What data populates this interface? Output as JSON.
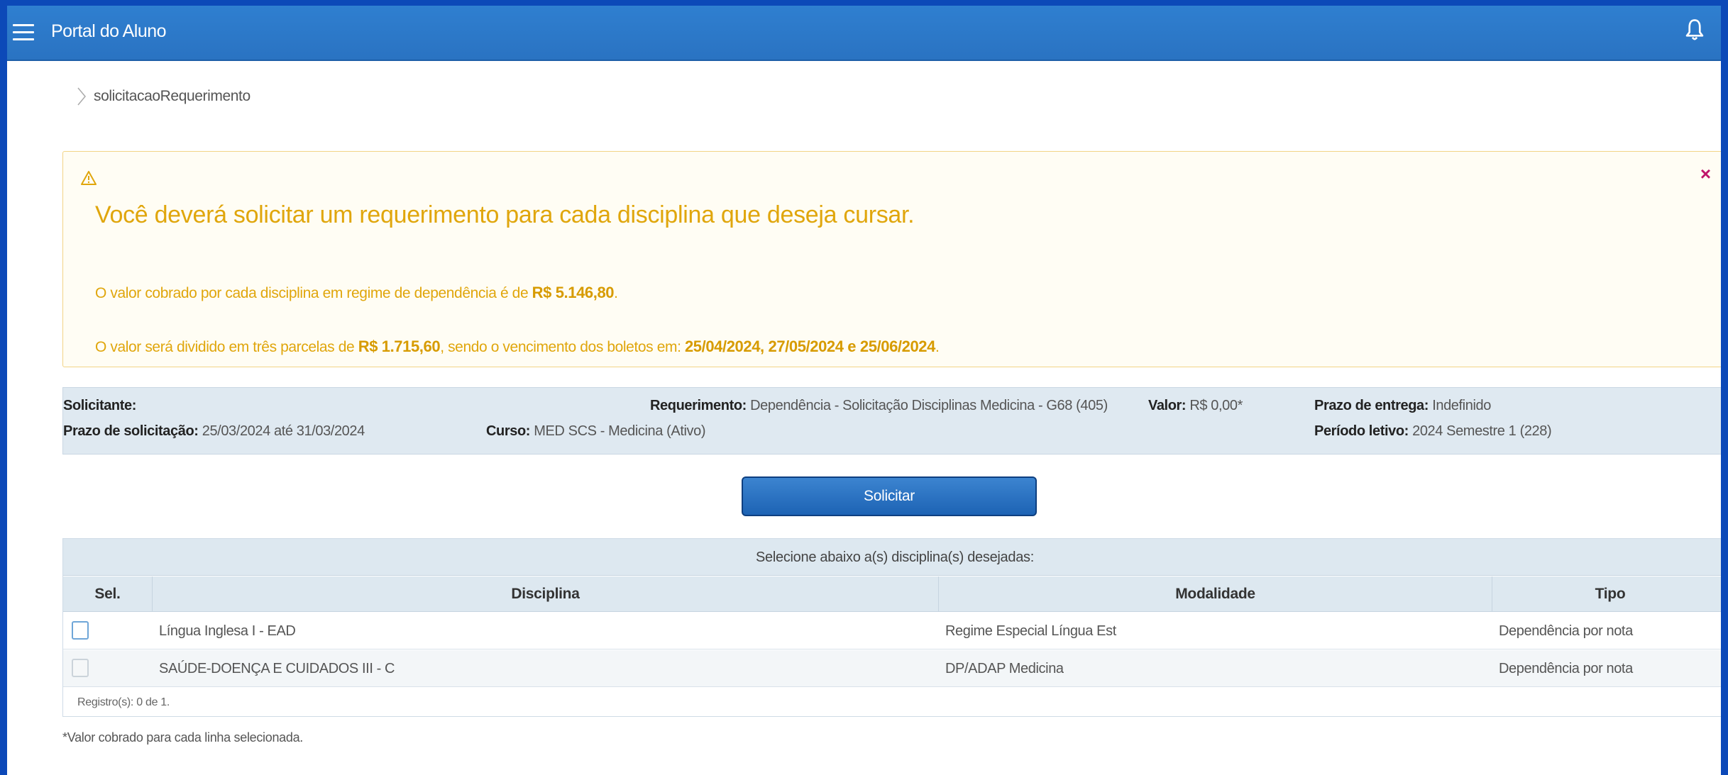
{
  "header": {
    "title": "Portal do Aluno",
    "menu_icon": "hamburger-menu-icon",
    "bell_icon": "bell-icon"
  },
  "breadcrumb": {
    "current": "solicitacaoRequerimento"
  },
  "alert": {
    "icon": "warning-icon",
    "close": "×",
    "heading": "Você deverá solicitar um requerimento para cada disciplina que deseja cursar.",
    "line1_prefix": "O valor cobrado por cada disciplina em regime de dependência é de ",
    "line1_value": "R$ 5.146,80",
    "line1_suffix": ".",
    "line2_prefix": "O valor será dividido em três parcelas de ",
    "line2_value": "R$ 1.715,60",
    "line2_mid": ", sendo o vencimento dos boletos em: ",
    "line2_dates": "25/04/2024, 27/05/2024 e 25/06/2024",
    "line2_suffix": ".",
    "color": "#e0a60c"
  },
  "info": {
    "solicitante_label": "Solicitante",
    "solicitante_value": "",
    "requerimento_label": "Requerimento",
    "requerimento_value": "Dependência - Solicitação Disciplinas Medicina - G68 (405)",
    "valor_label": "Valor",
    "valor_value": "R$ 0,00*",
    "prazo_entrega_label": "Prazo de entrega",
    "prazo_entrega_value": "Indefinido",
    "prazo_solicitacao_label": "Prazo de solicitação",
    "prazo_solicitacao_value": "25/03/2024 até 31/03/2024",
    "curso_label": "Curso",
    "curso_value": "MED SCS - Medicina (Ativo)",
    "periodo_label": "Período letivo",
    "periodo_value": "2024 Semestre 1 (228)"
  },
  "actions": {
    "solicitar": "Solicitar"
  },
  "table": {
    "caption": "Selecione abaixo a(s) disciplina(s) desejadas:",
    "columns": [
      "Sel.",
      "Disciplina",
      "Modalidade",
      "Tipo"
    ],
    "rows": [
      {
        "selected": false,
        "enabled": true,
        "disciplina": "Língua Inglesa I - EAD",
        "modalidade": "Regime Especial Língua Est",
        "tipo": "Dependência por nota"
      },
      {
        "selected": false,
        "enabled": false,
        "disciplina": "SAÚDE-DOENÇA E CUIDADOS III - C",
        "modalidade": "DP/ADAP Medicina",
        "tipo": "Dependência por nota"
      }
    ],
    "registros": "Registro(s): 0 de 1."
  },
  "footnote": "*Valor cobrado para cada linha selecionada."
}
